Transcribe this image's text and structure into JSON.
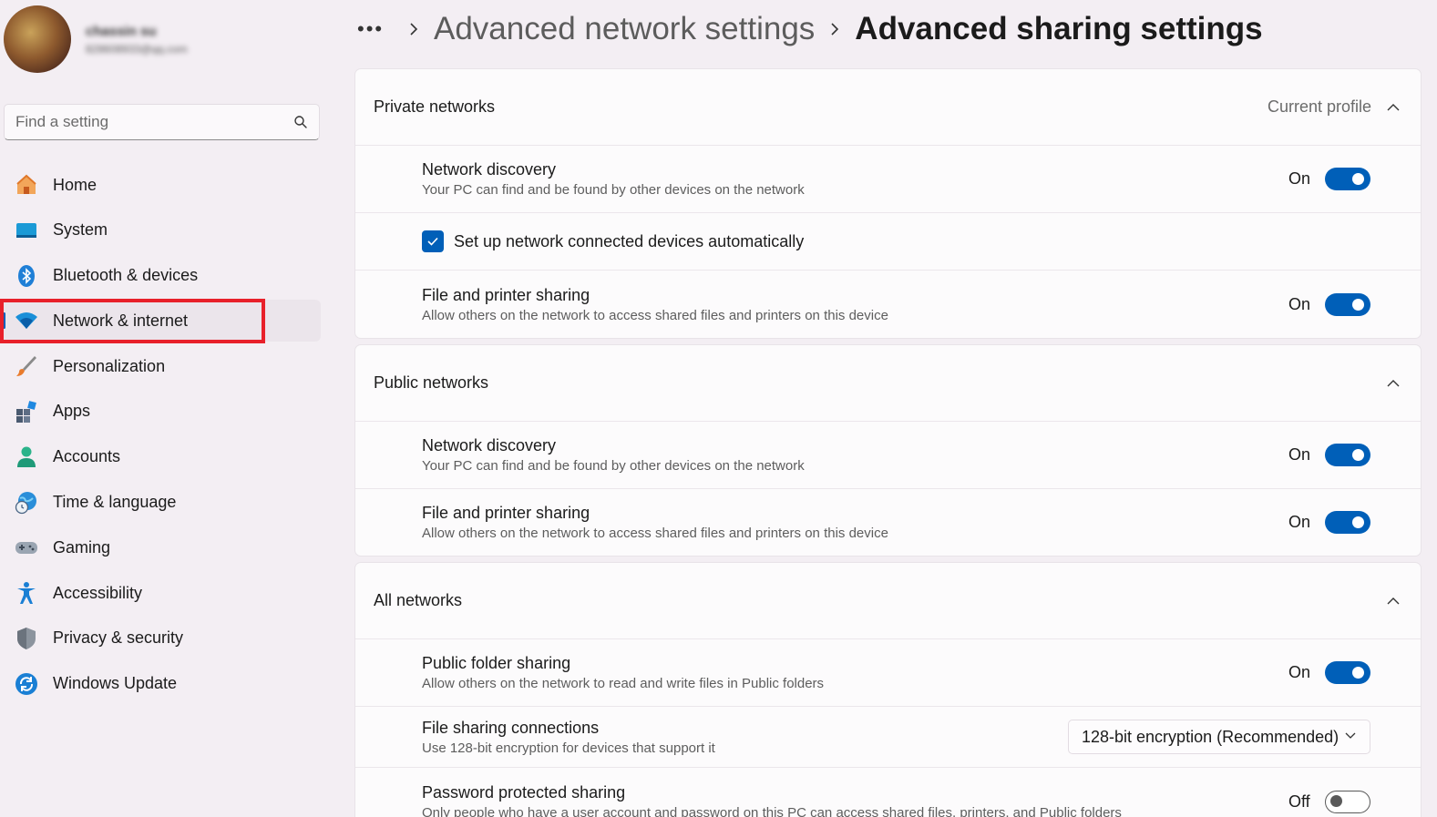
{
  "profile": {
    "name": "chassin su",
    "email": "828608933@qq.com"
  },
  "search": {
    "placeholder": "Find a setting"
  },
  "nav": [
    {
      "label": "Home",
      "icon": "home-icon"
    },
    {
      "label": "System",
      "icon": "system-icon"
    },
    {
      "label": "Bluetooth & devices",
      "icon": "bluetooth-icon"
    },
    {
      "label": "Network & internet",
      "icon": "wifi-icon",
      "active": true
    },
    {
      "label": "Personalization",
      "icon": "brush-icon"
    },
    {
      "label": "Apps",
      "icon": "apps-icon"
    },
    {
      "label": "Accounts",
      "icon": "person-icon"
    },
    {
      "label": "Time & language",
      "icon": "globe-clock-icon"
    },
    {
      "label": "Gaming",
      "icon": "gamepad-icon"
    },
    {
      "label": "Accessibility",
      "icon": "accessibility-icon"
    },
    {
      "label": "Privacy & security",
      "icon": "shield-icon"
    },
    {
      "label": "Windows Update",
      "icon": "update-icon"
    }
  ],
  "breadcrumb": {
    "more": "•••",
    "parent": "Advanced network settings",
    "current": "Advanced sharing settings"
  },
  "sections": {
    "private": {
      "title": "Private networks",
      "status": "Current profile",
      "discovery": {
        "title": "Network discovery",
        "desc": "Your PC can find and be found by other devices on the network",
        "state": "On"
      },
      "auto_setup": {
        "label": "Set up network connected devices automatically",
        "checked": true
      },
      "sharing": {
        "title": "File and printer sharing",
        "desc": "Allow others on the network to access shared files and printers on this device",
        "state": "On"
      }
    },
    "public": {
      "title": "Public networks",
      "discovery": {
        "title": "Network discovery",
        "desc": "Your PC can find and be found by other devices on the network",
        "state": "On"
      },
      "sharing": {
        "title": "File and printer sharing",
        "desc": "Allow others on the network to access shared files and printers on this device",
        "state": "On"
      }
    },
    "all": {
      "title": "All networks",
      "public_folder": {
        "title": "Public folder sharing",
        "desc": "Allow others on the network to read and write files in Public folders",
        "state": "On"
      },
      "connections": {
        "title": "File sharing connections",
        "desc": "Use 128-bit encryption for devices that support it",
        "value": "128-bit encryption (Recommended)"
      },
      "password": {
        "title": "Password protected sharing",
        "desc": "Only people who have a user account and password on this PC can access shared files, printers, and Public folders",
        "state": "Off"
      }
    }
  },
  "colors": {
    "accent": "#005fb8",
    "highlight": "#e8202a"
  }
}
